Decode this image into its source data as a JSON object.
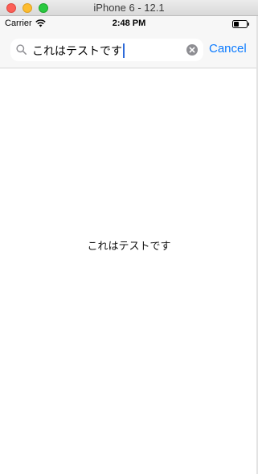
{
  "window": {
    "title": "iPhone 6 - 12.1"
  },
  "statusbar": {
    "carrier": "Carrier",
    "time": "2:48 PM",
    "wifi_icon": "wifi-icon",
    "battery_icon": "battery-icon"
  },
  "search": {
    "query": "これはテストです",
    "search_icon": "search-icon",
    "clear_icon": "clear-icon",
    "cancel_label": "Cancel"
  },
  "content": {
    "label": "これはテストです"
  },
  "colors": {
    "accent": "#0a7aff",
    "caret": "#2f6bd9"
  }
}
